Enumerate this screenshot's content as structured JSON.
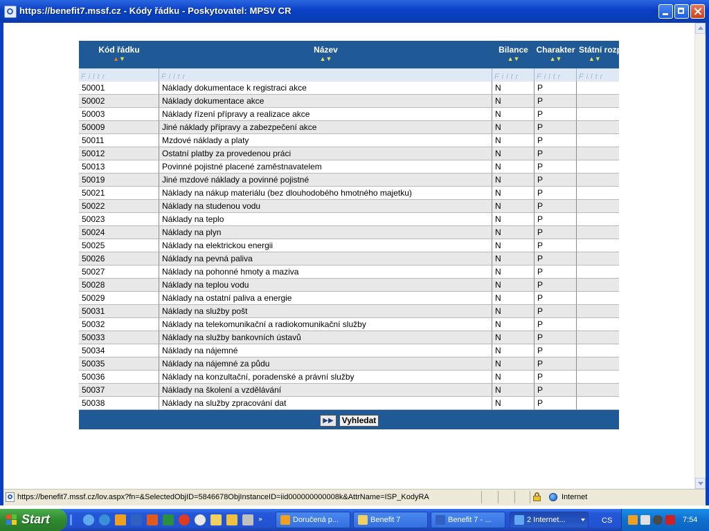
{
  "window": {
    "title": "https://benefit7.mssf.cz - Kódy řádku - Poskytovatel: MPSV CR"
  },
  "table": {
    "columns": [
      {
        "label": "Kód řádku",
        "sort_active": "up"
      },
      {
        "label": "Název",
        "sort_active": ""
      },
      {
        "label": "Bilance",
        "sort_active": ""
      },
      {
        "label": "Charakter",
        "sort_active": ""
      },
      {
        "label": "Státní rozp",
        "sort_active": ""
      }
    ],
    "sort_up_glyph": "▲",
    "sort_down_glyph": "▼",
    "filter_placeholder": "Filtr",
    "rows": [
      {
        "code": "50001",
        "name": "Náklady dokumentace k registraci akce",
        "bilance": "N",
        "charakter": "P",
        "statni": ""
      },
      {
        "code": "50002",
        "name": "Náklady dokumentace akce",
        "bilance": "N",
        "charakter": "P",
        "statni": ""
      },
      {
        "code": "50003",
        "name": "Náklady řízení přípravy a realizace akce",
        "bilance": "N",
        "charakter": "P",
        "statni": ""
      },
      {
        "code": "50009",
        "name": "Jiné náklady přípravy a zabezpečení akce",
        "bilance": "N",
        "charakter": "P",
        "statni": ""
      },
      {
        "code": "50011",
        "name": "Mzdové náklady a platy",
        "bilance": "N",
        "charakter": "P",
        "statni": ""
      },
      {
        "code": "50012",
        "name": "Ostatní platby za provedenou práci",
        "bilance": "N",
        "charakter": "P",
        "statni": ""
      },
      {
        "code": "50013",
        "name": "Povinné pojistné placené zaměstnavatelem",
        "bilance": "N",
        "charakter": "P",
        "statni": ""
      },
      {
        "code": "50019",
        "name": "Jiné mzdové náklady a povinné pojistné",
        "bilance": "N",
        "charakter": "P",
        "statni": ""
      },
      {
        "code": "50021",
        "name": "Náklady na nákup materiálu (bez dlouhodobého hmotného majetku)",
        "bilance": "N",
        "charakter": "P",
        "statni": ""
      },
      {
        "code": "50022",
        "name": "Náklady na studenou vodu",
        "bilance": "N",
        "charakter": "P",
        "statni": ""
      },
      {
        "code": "50023",
        "name": "Náklady na teplo",
        "bilance": "N",
        "charakter": "P",
        "statni": ""
      },
      {
        "code": "50024",
        "name": "Náklady na plyn",
        "bilance": "N",
        "charakter": "P",
        "statni": ""
      },
      {
        "code": "50025",
        "name": "Náklady na elektrickou energii",
        "bilance": "N",
        "charakter": "P",
        "statni": ""
      },
      {
        "code": "50026",
        "name": "Náklady na pevná paliva",
        "bilance": "N",
        "charakter": "P",
        "statni": ""
      },
      {
        "code": "50027",
        "name": "Náklady na pohonné hmoty a maziva",
        "bilance": "N",
        "charakter": "P",
        "statni": ""
      },
      {
        "code": "50028",
        "name": "Náklady na teplou vodu",
        "bilance": "N",
        "charakter": "P",
        "statni": ""
      },
      {
        "code": "50029",
        "name": "Náklady na ostatní paliva a energie",
        "bilance": "N",
        "charakter": "P",
        "statni": ""
      },
      {
        "code": "50031",
        "name": "Náklady na služby pošt",
        "bilance": "N",
        "charakter": "P",
        "statni": ""
      },
      {
        "code": "50032",
        "name": "Náklady na telekomunikační a radiokomunikační služby",
        "bilance": "N",
        "charakter": "P",
        "statni": ""
      },
      {
        "code": "50033",
        "name": "Náklady na služby bankovních ústavů",
        "bilance": "N",
        "charakter": "P",
        "statni": ""
      },
      {
        "code": "50034",
        "name": "Náklady na nájemné",
        "bilance": "N",
        "charakter": "P",
        "statni": ""
      },
      {
        "code": "50035",
        "name": "Náklady na nájemné za půdu",
        "bilance": "N",
        "charakter": "P",
        "statni": ""
      },
      {
        "code": "50036",
        "name": "Náklady na konzultační, poradenské a právní služby",
        "bilance": "N",
        "charakter": "P",
        "statni": ""
      },
      {
        "code": "50037",
        "name": "Náklady na školení a vzdělávání",
        "bilance": "N",
        "charakter": "P",
        "statni": ""
      },
      {
        "code": "50038",
        "name": "Náklady na služby zpracování dat",
        "bilance": "N",
        "charakter": "P",
        "statni": ""
      }
    ],
    "next_page_glyph": "▶▶",
    "search_label": "Vyhledat"
  },
  "statusbar": {
    "url": "https://benefit7.mssf.cz/lov.aspx?fn=&SelectedObjID=5846678ObjInstanceID=iid000000000008k&AttrName=ISP_KodyRA",
    "zone": "Internet"
  },
  "taskbar": {
    "start_label": "Start",
    "tasks": [
      {
        "label": "Doručená p...",
        "icon": "outlook-clock-icon",
        "color": "#f0a020",
        "active": false,
        "has_dropdown": false
      },
      {
        "label": "Benefit 7",
        "icon": "folder-icon",
        "color": "#f0d060",
        "active": false,
        "has_dropdown": false
      },
      {
        "label": "Benefit 7 - ...",
        "icon": "word-icon",
        "color": "#3060c0",
        "active": false,
        "has_dropdown": false
      },
      {
        "label": "2 Internet...",
        "icon": "internet-explorer-icon",
        "color": "#60a8f0",
        "active": true,
        "has_dropdown": true
      }
    ],
    "language": "CS",
    "clock": "7:54"
  },
  "colors": {
    "header_blue": "#1f5a96",
    "filter_bg": "#dfe9f6",
    "row_alt": "#e8e8e8"
  }
}
